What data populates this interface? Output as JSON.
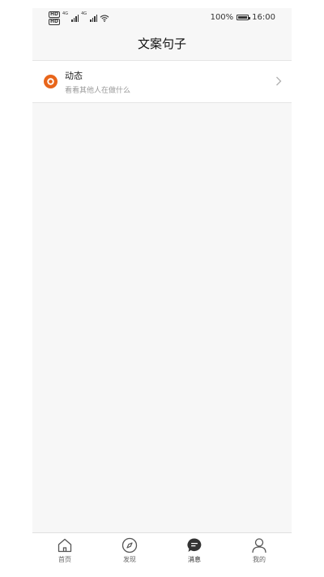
{
  "status_bar": {
    "hd_label": "HD",
    "network_1": "4G",
    "network_2": "4G",
    "battery": "100%",
    "time": "16:00"
  },
  "header": {
    "title": "文案句子"
  },
  "list": {
    "items": [
      {
        "title": "动态",
        "subtitle": "看看其他人在做什么",
        "icon": "record-icon",
        "icon_color": "#e8651a"
      }
    ]
  },
  "bottom_nav": {
    "active_index": 2,
    "items": [
      {
        "label": "首页",
        "icon": "home-icon"
      },
      {
        "label": "发现",
        "icon": "compass-icon"
      },
      {
        "label": "消息",
        "icon": "message-icon"
      },
      {
        "label": "我的",
        "icon": "user-icon"
      }
    ]
  }
}
